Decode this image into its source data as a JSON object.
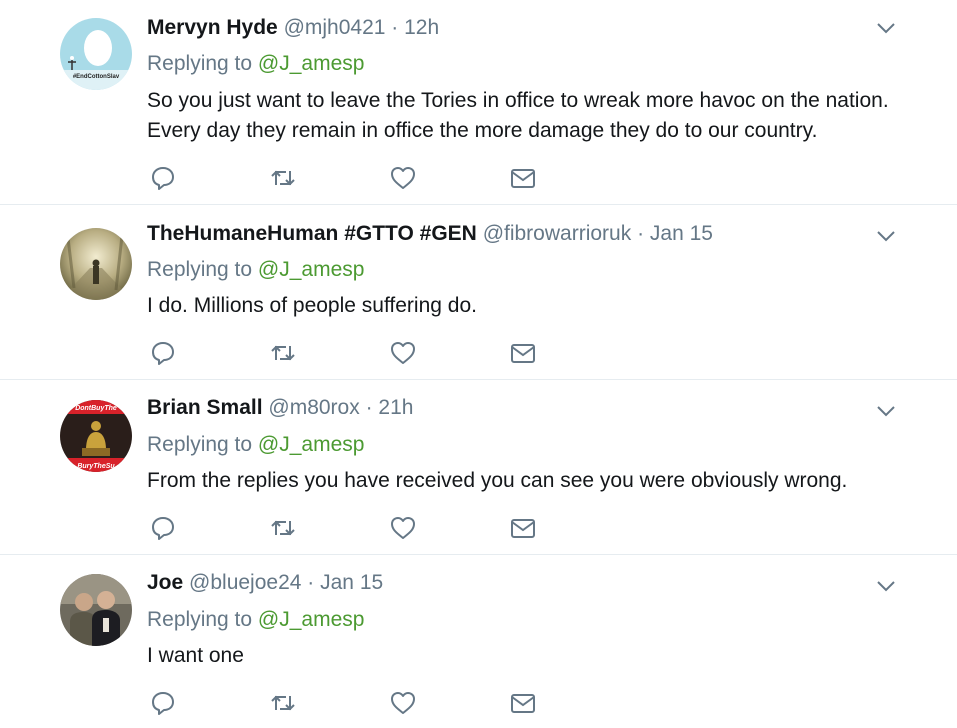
{
  "colors": {
    "name": "#14171a",
    "secondary": "#657786",
    "mention": "#4c9a32",
    "icon": "#657786",
    "divider": "#e6ecf0"
  },
  "icons": {
    "reply": "reply-icon",
    "retweet": "retweet-icon",
    "like": "like-icon",
    "dm": "direct-message-icon",
    "more": "chevron-down-icon"
  },
  "tweets": [
    {
      "name": "Mervyn Hyde",
      "handle": "@mjh0421",
      "dot": "·",
      "time": "12h",
      "replying_prefix": "Replying to ",
      "replying_handle": "@J_amesp",
      "text": "So you just want to leave the Tories in office to wreak more havoc on the nation. Every day they remain in office the more damage they do to our country.",
      "avatar_caption": "#EndCottonSlav"
    },
    {
      "name": "TheHumaneHuman #GTTO #GEN",
      "handle": "@fibrowarrioruk",
      "dot": "·",
      "time": "Jan 15",
      "replying_prefix": "Replying to ",
      "replying_handle": "@J_amesp",
      "text": "I do. Millions of people suffering do."
    },
    {
      "name": "Brian Small",
      "handle": "@m80rox",
      "dot": "·",
      "time": "21h",
      "replying_prefix": "Replying to ",
      "replying_handle": "@J_amesp",
      "text": "From the replies you have received you can see you were obviously wrong.",
      "avatar_caption_top": "DontBuyThe",
      "avatar_caption_bottom": "BuryTheSu"
    },
    {
      "name": "Joe",
      "handle": "@bluejoe24",
      "dot": "·",
      "time": "Jan 15",
      "replying_prefix": "Replying to ",
      "replying_handle": "@J_amesp",
      "text": "I want one"
    }
  ]
}
